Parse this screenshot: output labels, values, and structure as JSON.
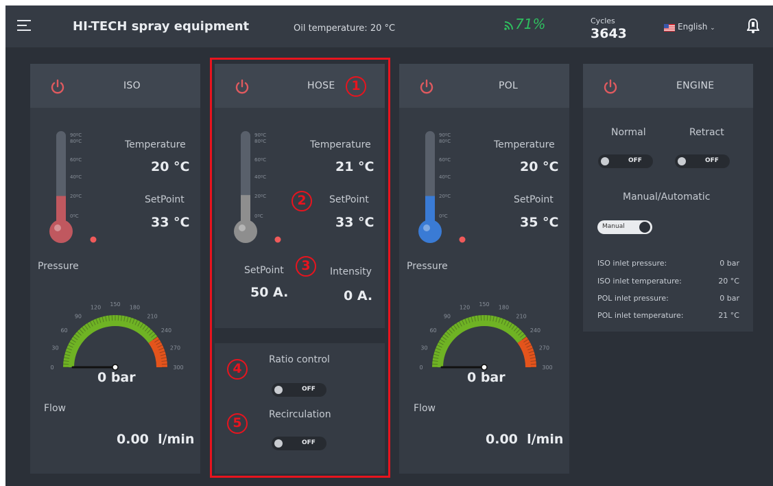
{
  "header": {
    "app_title": "HI-TECH spray equipment",
    "oil_temperature": "Oil temperature: 20 °C",
    "signal_strength": "71%",
    "cycles_label": "Cycles",
    "cycles_value": "3643",
    "language": "English",
    "icons": [
      "hamburger-menu-icon",
      "signal-icon",
      "us-flag-icon",
      "chevron-down-icon",
      "bell-icon"
    ],
    "colors": {
      "signal": "#2fbf5f",
      "accent_red": "#e8141e",
      "power": "#e05a5f"
    }
  },
  "iso": {
    "title": "ISO",
    "temperature_label": "Temperature",
    "temperature_value": "20 °C",
    "setpoint_label": "SetPoint",
    "setpoint_value": "33 °C",
    "pressure_label": "Pressure",
    "pressure_value": "0 bar",
    "flow_label": "Flow",
    "flow_value": "0.00  l/min",
    "thermo_color": "#c0585f",
    "thermo_level_fraction": 0.22
  },
  "hose": {
    "title": "HOSE",
    "temperature_label": "Temperature",
    "temperature_value": "21 °C",
    "setpoint_label": "SetPoint",
    "setpoint_value": "33 °C",
    "current_setpoint_label": "SetPoint",
    "current_setpoint_value": "50 A.",
    "intensity_label": "Intensity",
    "intensity_value": "0 A.",
    "ratio_control_label": "Ratio control",
    "ratio_control_state": "OFF",
    "recirculation_label": "Recirculation",
    "recirculation_state": "OFF",
    "thermo_color": "#8e8e8e",
    "thermo_level_fraction": 0.23
  },
  "pol": {
    "title": "POL",
    "temperature_label": "Temperature",
    "temperature_value": "20 °C",
    "setpoint_label": "SetPoint",
    "setpoint_value": "35 °C",
    "pressure_label": "Pressure",
    "pressure_value": "0 bar",
    "flow_label": "Flow",
    "flow_value": "0.00  l/min",
    "thermo_color": "#3a7bd5",
    "thermo_level_fraction": 0.22
  },
  "engine": {
    "title": "ENGINE",
    "normal_label": "Normal",
    "normal_state": "OFF",
    "retract_label": "Retract",
    "retract_state": "OFF",
    "mode_label": "Manual/Automatic",
    "mode_state": "Manual",
    "readings": [
      {
        "label": "ISO inlet pressure:",
        "value": "0 bar"
      },
      {
        "label": "ISO inlet temperature:",
        "value": "20 °C"
      },
      {
        "label": "POL inlet pressure:",
        "value": "0 bar"
      },
      {
        "label": "POL inlet temperature:",
        "value": "21 °C"
      }
    ]
  },
  "thermometer_scale": [
    "90ºC",
    "80ºC",
    "60ºC",
    "40ºC",
    "20ºC",
    "0ºC"
  ],
  "gauge_scale": [
    "0",
    "30",
    "60",
    "90",
    "120",
    "150",
    "180",
    "210",
    "240",
    "270",
    "300"
  ],
  "gauge_needle_value": 0,
  "annotations": [
    "1",
    "2",
    "3",
    "4",
    "5"
  ]
}
